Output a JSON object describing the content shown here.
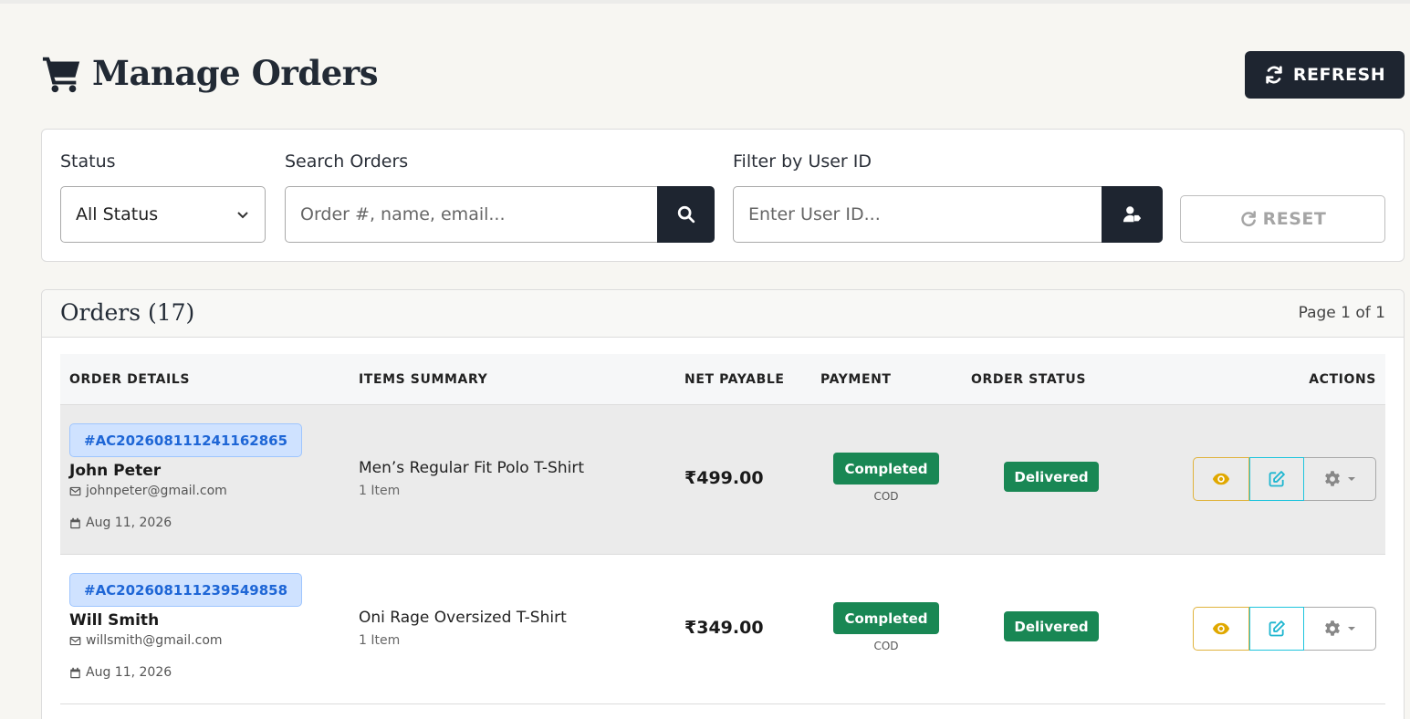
{
  "header": {
    "title": "Manage Orders",
    "refresh_label": "REFRESH"
  },
  "filters": {
    "status_label": "Status",
    "status_value": "All Status",
    "search_label": "Search Orders",
    "search_placeholder": "Order #, name, email...",
    "user_label": "Filter by User ID",
    "user_placeholder": "Enter User ID...",
    "reset_label": "RESET"
  },
  "orders": {
    "title": "Orders (17)",
    "page_info": "Page 1 of 1",
    "columns": [
      "ORDER DETAILS",
      "ITEMS SUMMARY",
      "NET PAYABLE",
      "PAYMENT",
      "ORDER STATUS",
      "ACTIONS"
    ],
    "rows": [
      {
        "order_id": "#AC202608111241162865",
        "name": "John Peter",
        "email": "johnpeter@gmail.com",
        "date": "Aug 11, 2026",
        "item": "Men’s Regular Fit Polo T-Shirt",
        "item_count": "1 Item",
        "net": "₹499.00",
        "payment_status": "Completed",
        "payment_method": "COD",
        "order_status": "Delivered"
      },
      {
        "order_id": "#AC202608111239549858",
        "name": "Will Smith",
        "email": "willsmith@gmail.com",
        "date": "Aug 11, 2026",
        "item": "Oni Rage Oversized T-Shirt",
        "item_count": "1 Item",
        "net": "₹349.00",
        "payment_status": "Completed",
        "payment_method": "COD",
        "order_status": "Delivered"
      }
    ]
  },
  "colors": {
    "dark": "#1e2530",
    "success": "#198754",
    "badge_blue_bg": "#cfe2ff",
    "badge_blue_text": "#1e66d6",
    "view_border": "#e0b33d",
    "edit_border": "#1fc4dd"
  },
  "icons": [
    "cart-icon",
    "refresh-icon",
    "chevron-down-icon",
    "search-icon",
    "user-tag-icon",
    "reset-icon",
    "envelope-icon",
    "calendar-icon",
    "eye-icon",
    "edit-icon",
    "gear-icon",
    "caret-down-icon"
  ]
}
